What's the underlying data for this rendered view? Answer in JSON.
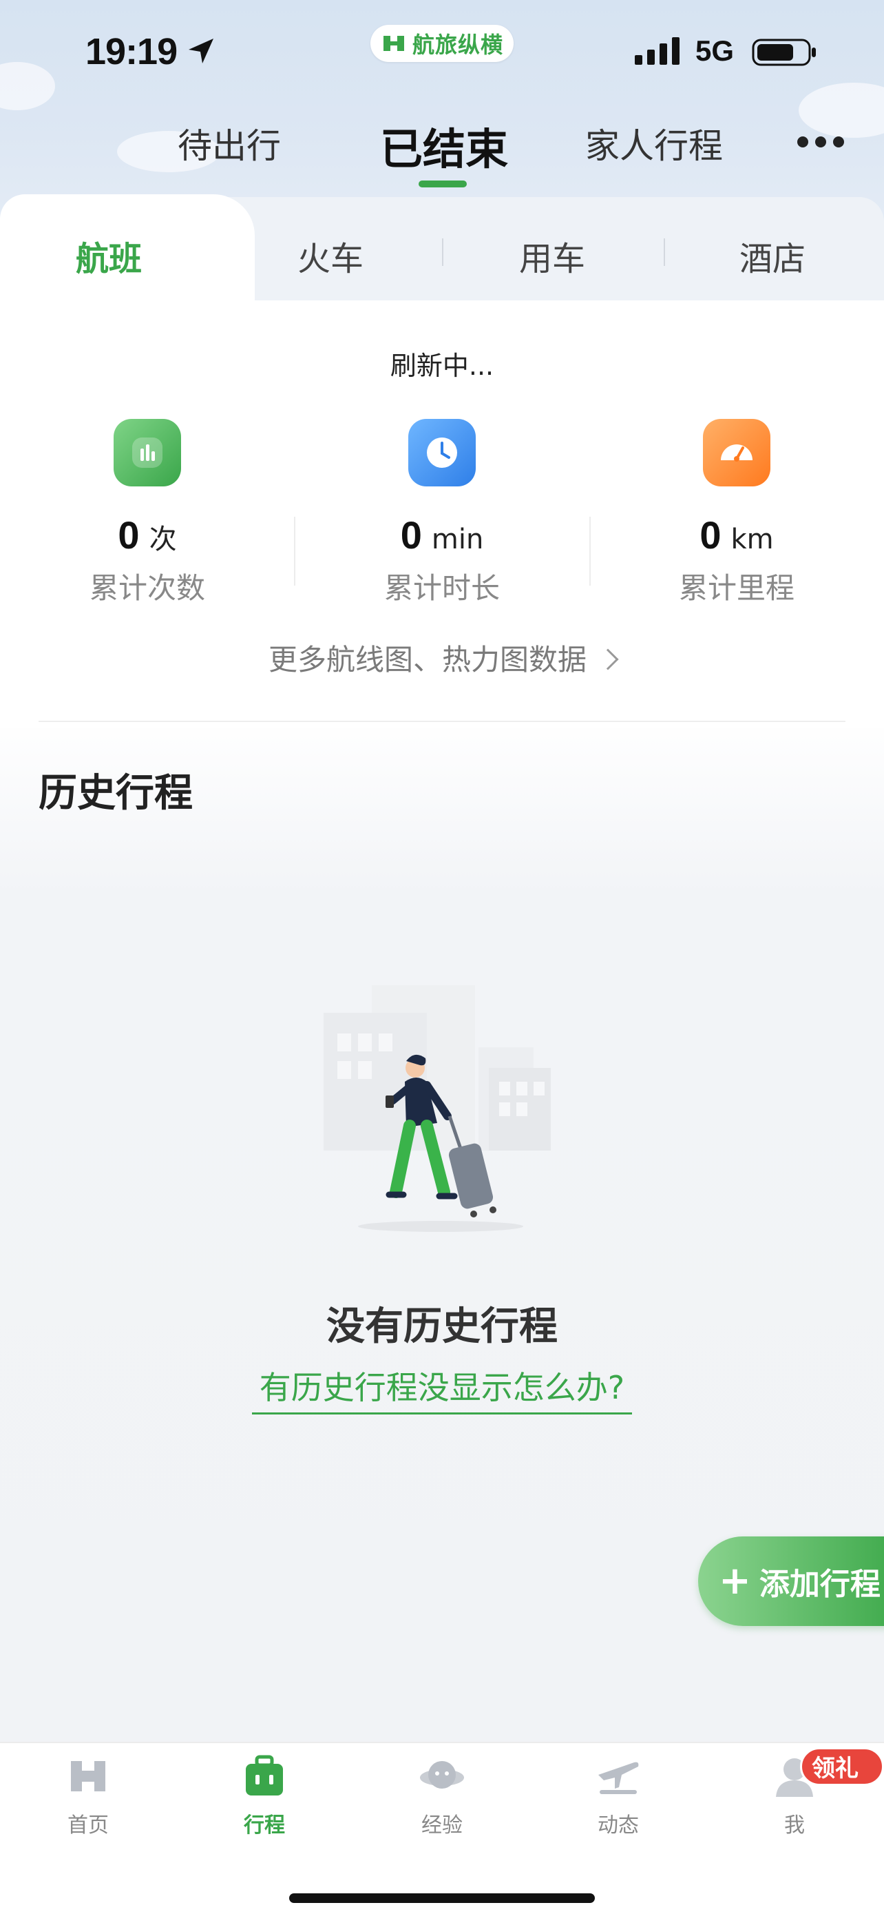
{
  "status_bar": {
    "time": "19:19",
    "network": "5G",
    "brand": "航旅纵横"
  },
  "top_tabs": [
    {
      "label": "待出行"
    },
    {
      "label": "已结束"
    },
    {
      "label": "家人行程"
    }
  ],
  "active_top_tab": "已结束",
  "segments": [
    {
      "label": "航班"
    },
    {
      "label": "火车"
    },
    {
      "label": "用车"
    },
    {
      "label": "酒店"
    }
  ],
  "refresh_text": "刷新中...",
  "stats": [
    {
      "value": "0",
      "unit": "次",
      "label": "累计次数",
      "icon": "bar-chart-icon",
      "color": "#4cb85a"
    },
    {
      "value": "0",
      "unit": "min",
      "label": "累计时长",
      "icon": "clock-icon",
      "color": "#3a8ef0"
    },
    {
      "value": "0",
      "unit": "km",
      "label": "累计里程",
      "icon": "speedometer-icon",
      "color": "#ff8a2a"
    }
  ],
  "more_data_link": "更多航线图、热力图数据",
  "history": {
    "title": "历史行程",
    "empty_title": "没有历史行程",
    "help_link": "有历史行程没显示怎么办?"
  },
  "add_button": {
    "label": "添加行程"
  },
  "bottom_nav": [
    {
      "label": "首页",
      "icon": "home-logo-icon"
    },
    {
      "label": "行程",
      "icon": "briefcase-icon"
    },
    {
      "label": "经验",
      "icon": "planet-icon"
    },
    {
      "label": "动态",
      "icon": "plane-icon"
    },
    {
      "label": "我",
      "icon": "profile-icon"
    }
  ],
  "gift_badge": "领礼金",
  "colors": {
    "accent": "#3aa64a",
    "badge": "#e8453c"
  }
}
